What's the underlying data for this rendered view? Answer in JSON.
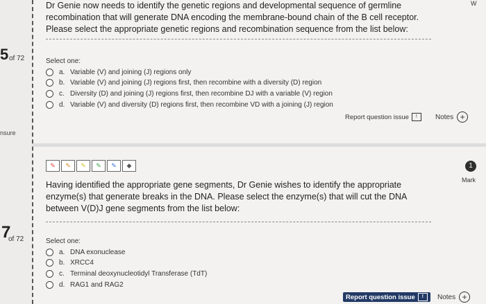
{
  "q1": {
    "number": "5",
    "of_label": "of 72",
    "stem": "Dr Genie now needs to identify the genetic regions and developmental sequence of germline recombination that will generate DNA encoding the membrane-bound chain of the B cell receptor. Please select the appropriate genetic regions and recombination sequence from the list below:",
    "select_one": "Select one:",
    "options": [
      {
        "letter": "a.",
        "text": "Variable (V) and joining (J) regions only"
      },
      {
        "letter": "b.",
        "text": "Variable (V) and joining (J) regions first, then recombine with a diversity (D) region"
      },
      {
        "letter": "c.",
        "text": "Diversity (D) and joining (J) regions first, then recombine DJ with a variable (V) region"
      },
      {
        "letter": "d.",
        "text": "Variable (V) and diversity (D) regions first, then recombine VD with a joining (J) region"
      }
    ],
    "report_label": "Report question issue",
    "notes_label": "Notes"
  },
  "left_status": "nsure",
  "top_right": "W",
  "q2": {
    "number": "7",
    "of_label": "of 72",
    "badge": "1",
    "mark_label": "Mark",
    "stem": "Having identified the appropriate gene segments, Dr Genie wishes to identify the appropriate enzyme(s) that generate breaks in the DNA. Please select the enzyme(s) that will cut the DNA between V(D)J gene segments from the list below:",
    "select_one": "Select one:",
    "options": [
      {
        "letter": "a.",
        "text": "DNA exonuclease"
      },
      {
        "letter": "b.",
        "text": "XRCC4"
      },
      {
        "letter": "c.",
        "text": "Terminal deoxynucleotidyl Transferase (TdT)"
      },
      {
        "letter": "d.",
        "text": "RAG1 and RAG2"
      }
    ],
    "report_label": "Report question issue",
    "notes_label": "Notes"
  },
  "toolbar": {
    "tools": [
      {
        "icon": "pen-red-icon",
        "color": "#e04444"
      },
      {
        "icon": "pen-orange-icon",
        "color": "#e08a2c"
      },
      {
        "icon": "pen-yellow-icon",
        "color": "#d8c22a"
      },
      {
        "icon": "pen-green-icon",
        "color": "#3aa64a"
      },
      {
        "icon": "pen-blue-icon",
        "color": "#3a6fd8"
      },
      {
        "icon": "eraser-icon",
        "color": "#555555"
      }
    ]
  },
  "colors": {
    "background": "#f3f2f0",
    "report_active_bg": "#233a66"
  }
}
